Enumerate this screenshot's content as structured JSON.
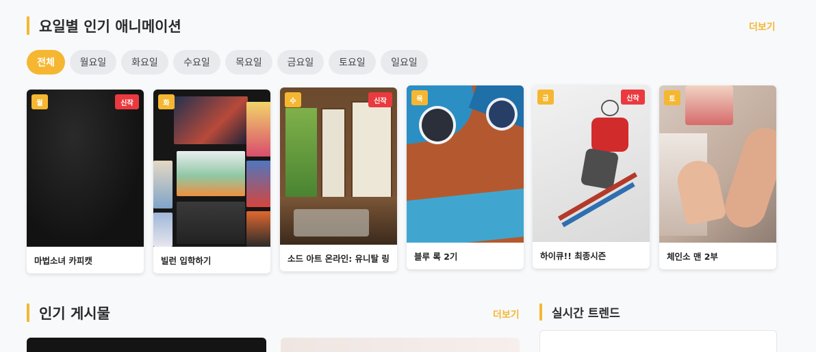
{
  "weekly": {
    "title": "요일별 인기 애니메이션",
    "more": "더보기",
    "tabs": [
      "전체",
      "월요일",
      "화요일",
      "수요일",
      "목요일",
      "금요일",
      "토요일",
      "일요일"
    ],
    "active_tab": "전체",
    "cards": [
      {
        "day": "월",
        "new": "신작",
        "title": "마법소녀 카피캣"
      },
      {
        "day": "화",
        "new": "",
        "title": "빌런 입학하기"
      },
      {
        "day": "수",
        "new": "신작",
        "title": "소드 아트 온라인: 유니탈 링"
      },
      {
        "day": "목",
        "new": "",
        "title": "블루 록 2기"
      },
      {
        "day": "금",
        "new": "신작",
        "title": "하이큐!! 최종시즌"
      },
      {
        "day": "토",
        "new": "",
        "title": "체인소 맨 2부"
      }
    ]
  },
  "popular_posts": {
    "title": "인기 게시물",
    "more": "더보기"
  },
  "trending": {
    "title": "실시간 트렌드"
  },
  "colors": {
    "accent": "#f5b731",
    "new_badge": "#ea3a3f",
    "background": "#f8f9fb"
  }
}
